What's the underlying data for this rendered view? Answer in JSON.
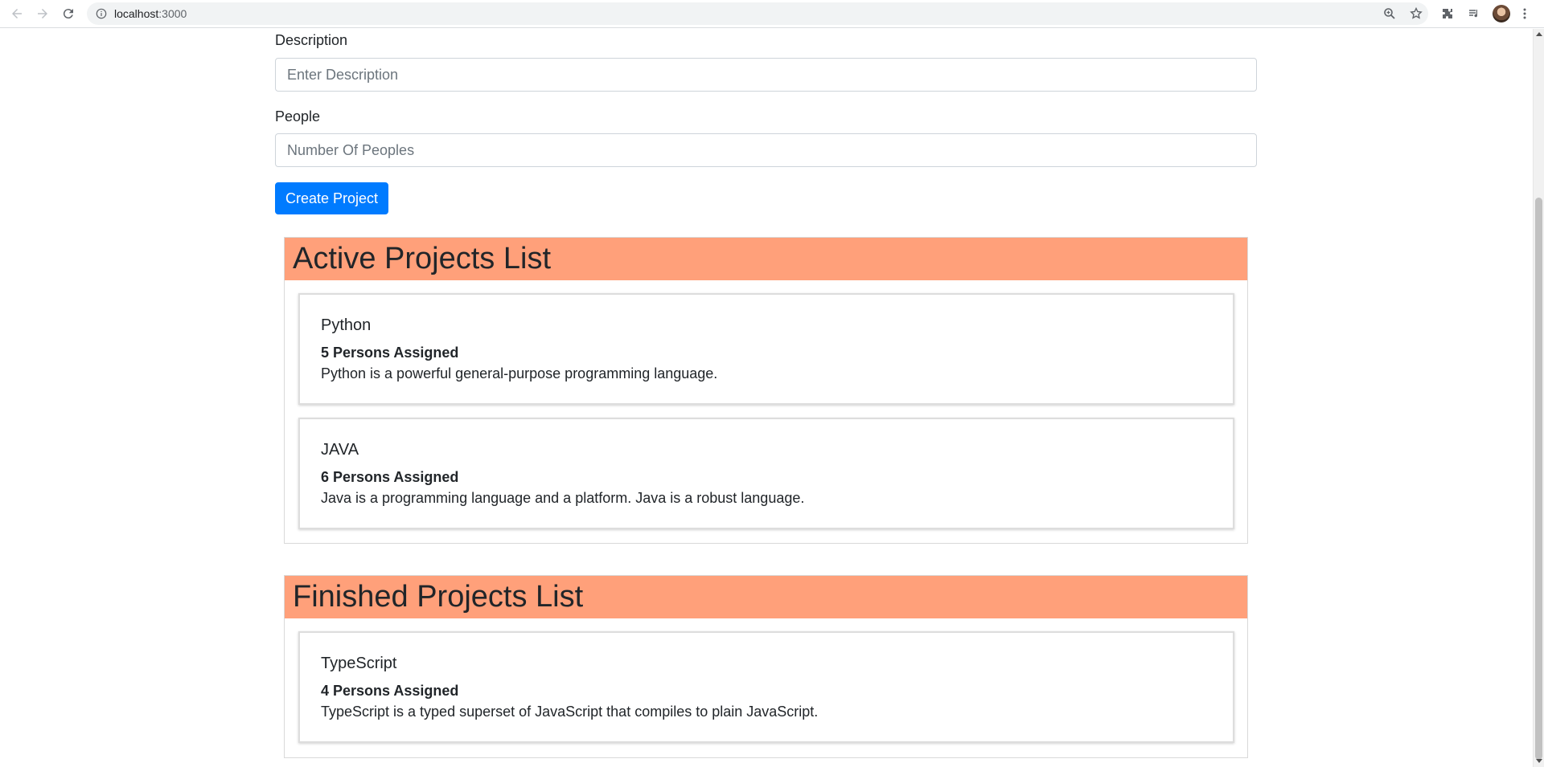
{
  "browser": {
    "url_host": "localhost",
    "url_port": ":3000"
  },
  "form": {
    "description_label": "Description",
    "description_placeholder": "Enter Description",
    "people_label": "People",
    "people_placeholder": "Number Of Peoples",
    "submit_label": "Create Project"
  },
  "active": {
    "heading": "Active Projects List",
    "projects": [
      {
        "title": "Python",
        "persons": "5 Persons Assigned",
        "description": "Python is a powerful general-purpose programming language."
      },
      {
        "title": "JAVA",
        "persons": "6 Persons Assigned",
        "description": "Java is a programming language and a platform. Java is a robust language."
      }
    ]
  },
  "finished": {
    "heading": "Finished Projects List",
    "projects": [
      {
        "title": "TypeScript",
        "persons": "4 Persons Assigned",
        "description": "TypeScript is a typed superset of JavaScript that compiles to plain JavaScript."
      }
    ]
  },
  "colors": {
    "header_bg": "#ffa07a",
    "primary_button": "#007bff"
  }
}
